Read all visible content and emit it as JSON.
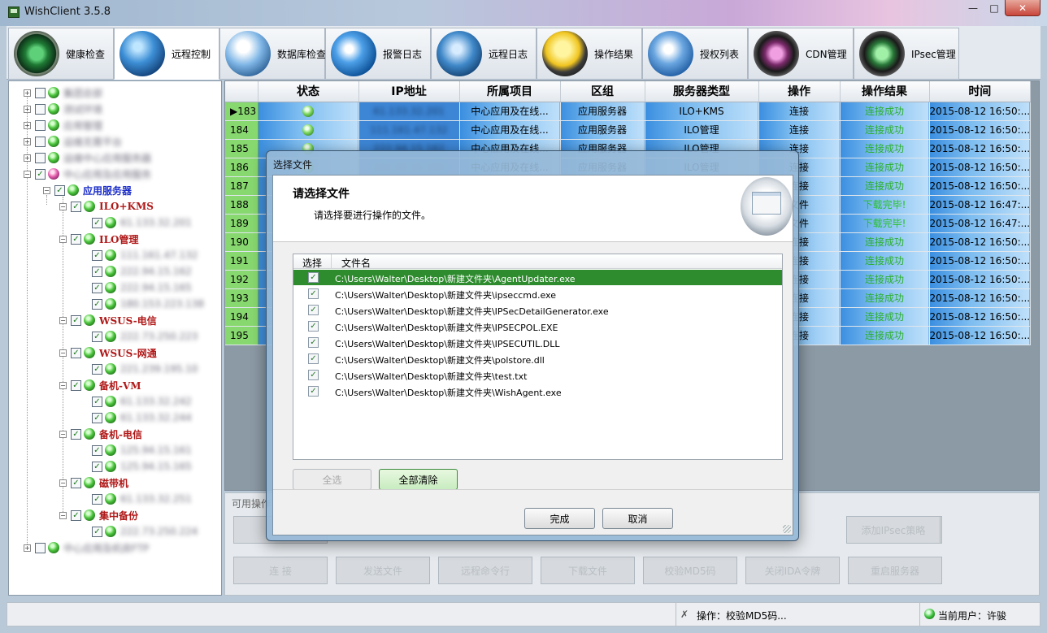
{
  "window": {
    "title": "WishClient",
    "version": "3.5.8",
    "min": "—",
    "max": "□",
    "close": "✕"
  },
  "tabs": [
    {
      "label": "健康检查",
      "icon": "radar-icon"
    },
    {
      "label": "远程控制",
      "icon": "globe-icon"
    },
    {
      "label": "数据库检查",
      "icon": "database-icon"
    },
    {
      "label": "报警日志",
      "icon": "speaker-icon"
    },
    {
      "label": "远程日志",
      "icon": "wrench-globe-icon"
    },
    {
      "label": "操作结果",
      "icon": "yellow-x-icon"
    },
    {
      "label": "授权列表",
      "icon": "shield-globe-icon"
    },
    {
      "label": "CDN管理",
      "icon": "yinyang-pink-icon"
    },
    {
      "label": "IPsec管理",
      "icon": "yinyang-green-icon"
    }
  ],
  "tree": {
    "groups_top": [
      "集团总部",
      "测试环境",
      "应用管理",
      "运维无需平台",
      "运维中心应用服务器"
    ],
    "root_selected": "中心应用及应用服务",
    "app_servers": "应用服务器",
    "subgroups": [
      {
        "label": "ILO+KMS",
        "ips": [
          "61.133.32.201"
        ]
      },
      {
        "label": "ILO管理",
        "ips": [
          "111.161.47.132",
          "222.94.15.162",
          "222.94.15.165",
          "180.153.223.138"
        ]
      },
      {
        "label": "WSUS-电信",
        "ips": [
          "222.73.250.223"
        ]
      },
      {
        "label": "WSUS-网通",
        "ips": [
          "221.239.195.10"
        ]
      },
      {
        "label": "备机-VM",
        "ips": [
          "61.133.32.242",
          "61.133.32.244"
        ]
      },
      {
        "label": "备机-电信",
        "ips": [
          "125.94.15.161",
          "125.94.15.165"
        ]
      },
      {
        "label": "磁带机",
        "ips": [
          "61.133.32.251"
        ]
      },
      {
        "label": "集中备份",
        "ips": [
          "222.73.250.224"
        ]
      }
    ],
    "bottom": "中心应用及机房FTP"
  },
  "grid": {
    "headers": [
      "状态",
      "IP地址",
      "所属项目",
      "区组",
      "服务器类型",
      "操作",
      "操作结果",
      "时间"
    ],
    "rows": [
      {
        "id": "183",
        "ip": "61.133.32.201",
        "project": "中心应用及在线...",
        "zone": "应用服务器",
        "type": "ILO+KMS",
        "op": "连接",
        "result": "连接成功",
        "time": "2015-08-12 16:50:..."
      },
      {
        "id": "184",
        "ip": "111.161.47.132",
        "project": "中心应用及在线...",
        "zone": "应用服务器",
        "type": "ILO管理",
        "op": "连接",
        "result": "连接成功",
        "time": "2015-08-12 16:50:..."
      },
      {
        "id": "185",
        "ip": "222.94.15.162",
        "project": "中心应用及在线...",
        "zone": "应用服务器",
        "type": "ILO管理",
        "op": "连接",
        "result": "连接成功",
        "time": "2015-08-12 16:50:..."
      },
      {
        "id": "186",
        "ip": "222.94.15.165",
        "project": "中心应用及在线...",
        "zone": "应用服务器",
        "type": "ILO管理",
        "op": "连接",
        "result": "连接成功",
        "time": "2015-08-12 16:50:..."
      },
      {
        "id": "187",
        "ip": "",
        "project": "",
        "zone": "",
        "type": "",
        "op": "连接",
        "result": "连接成功",
        "time": "2015-08-12 16:50:..."
      },
      {
        "id": "188",
        "ip": "",
        "project": "",
        "zone": "",
        "type": "",
        "op": "文件",
        "result": "下载完毕!",
        "time": "2015-08-12 16:47:..."
      },
      {
        "id": "189",
        "ip": "",
        "project": "",
        "zone": "",
        "type": "",
        "op": "文件",
        "result": "下载完毕!",
        "time": "2015-08-12 16:47:..."
      },
      {
        "id": "190",
        "ip": "",
        "project": "",
        "zone": "",
        "type": "",
        "op": "连接",
        "result": "连接成功",
        "time": "2015-08-12 16:50:..."
      },
      {
        "id": "191",
        "ip": "",
        "project": "",
        "zone": "",
        "type": "",
        "op": "连接",
        "result": "连接成功",
        "time": "2015-08-12 16:50:..."
      },
      {
        "id": "192",
        "ip": "",
        "project": "",
        "zone": "",
        "type": "",
        "op": "连接",
        "result": "连接成功",
        "time": "2015-08-12 16:50:..."
      },
      {
        "id": "193",
        "ip": "",
        "project": "",
        "zone": "",
        "type": "",
        "op": "连接",
        "result": "连接成功",
        "time": "2015-08-12 16:50:..."
      },
      {
        "id": "194",
        "ip": "",
        "project": "",
        "zone": "",
        "type": "",
        "op": "连接",
        "result": "连接成功",
        "time": "2015-08-12 16:50:..."
      },
      {
        "id": "195",
        "ip": "",
        "project": "",
        "zone": "",
        "type": "",
        "op": "连接",
        "result": "连接成功",
        "time": "2015-08-12 16:50:..."
      }
    ]
  },
  "ops": {
    "title": "可用操作",
    "row1_last": "添加IPsec策略",
    "row2": [
      "连  接",
      "发送文件",
      "远程命令行",
      "下载文件",
      "校验MD5码",
      "关闭IDA令牌",
      "重启服务器"
    ]
  },
  "status": {
    "operation": "操作：校验MD5码...",
    "user": "当前用户：许骏"
  },
  "dialog": {
    "title": "选择文件",
    "heading": "请选择文件",
    "subheading": "请选择要进行操作的文件。",
    "col_select": "选择",
    "col_filename": "文件名",
    "files": [
      "C:\\Users\\Walter\\Desktop\\新建文件夹\\AgentUpdater.exe",
      "C:\\Users\\Walter\\Desktop\\新建文件夹\\ipseccmd.exe",
      "C:\\Users\\Walter\\Desktop\\新建文件夹\\IPSecDetailGenerator.exe",
      "C:\\Users\\Walter\\Desktop\\新建文件夹\\IPSECPOL.EXE",
      "C:\\Users\\Walter\\Desktop\\新建文件夹\\IPSECUTIL.DLL",
      "C:\\Users\\Walter\\Desktop\\新建文件夹\\polstore.dll",
      "C:\\Users\\Walter\\Desktop\\新建文件夹\\test.txt",
      "C:\\Users\\Walter\\Desktop\\新建文件夹\\WishAgent.exe"
    ],
    "btn_select_all": "全选",
    "btn_clear_all": "全部清除",
    "btn_ok": "完成",
    "btn_cancel": "取消"
  }
}
